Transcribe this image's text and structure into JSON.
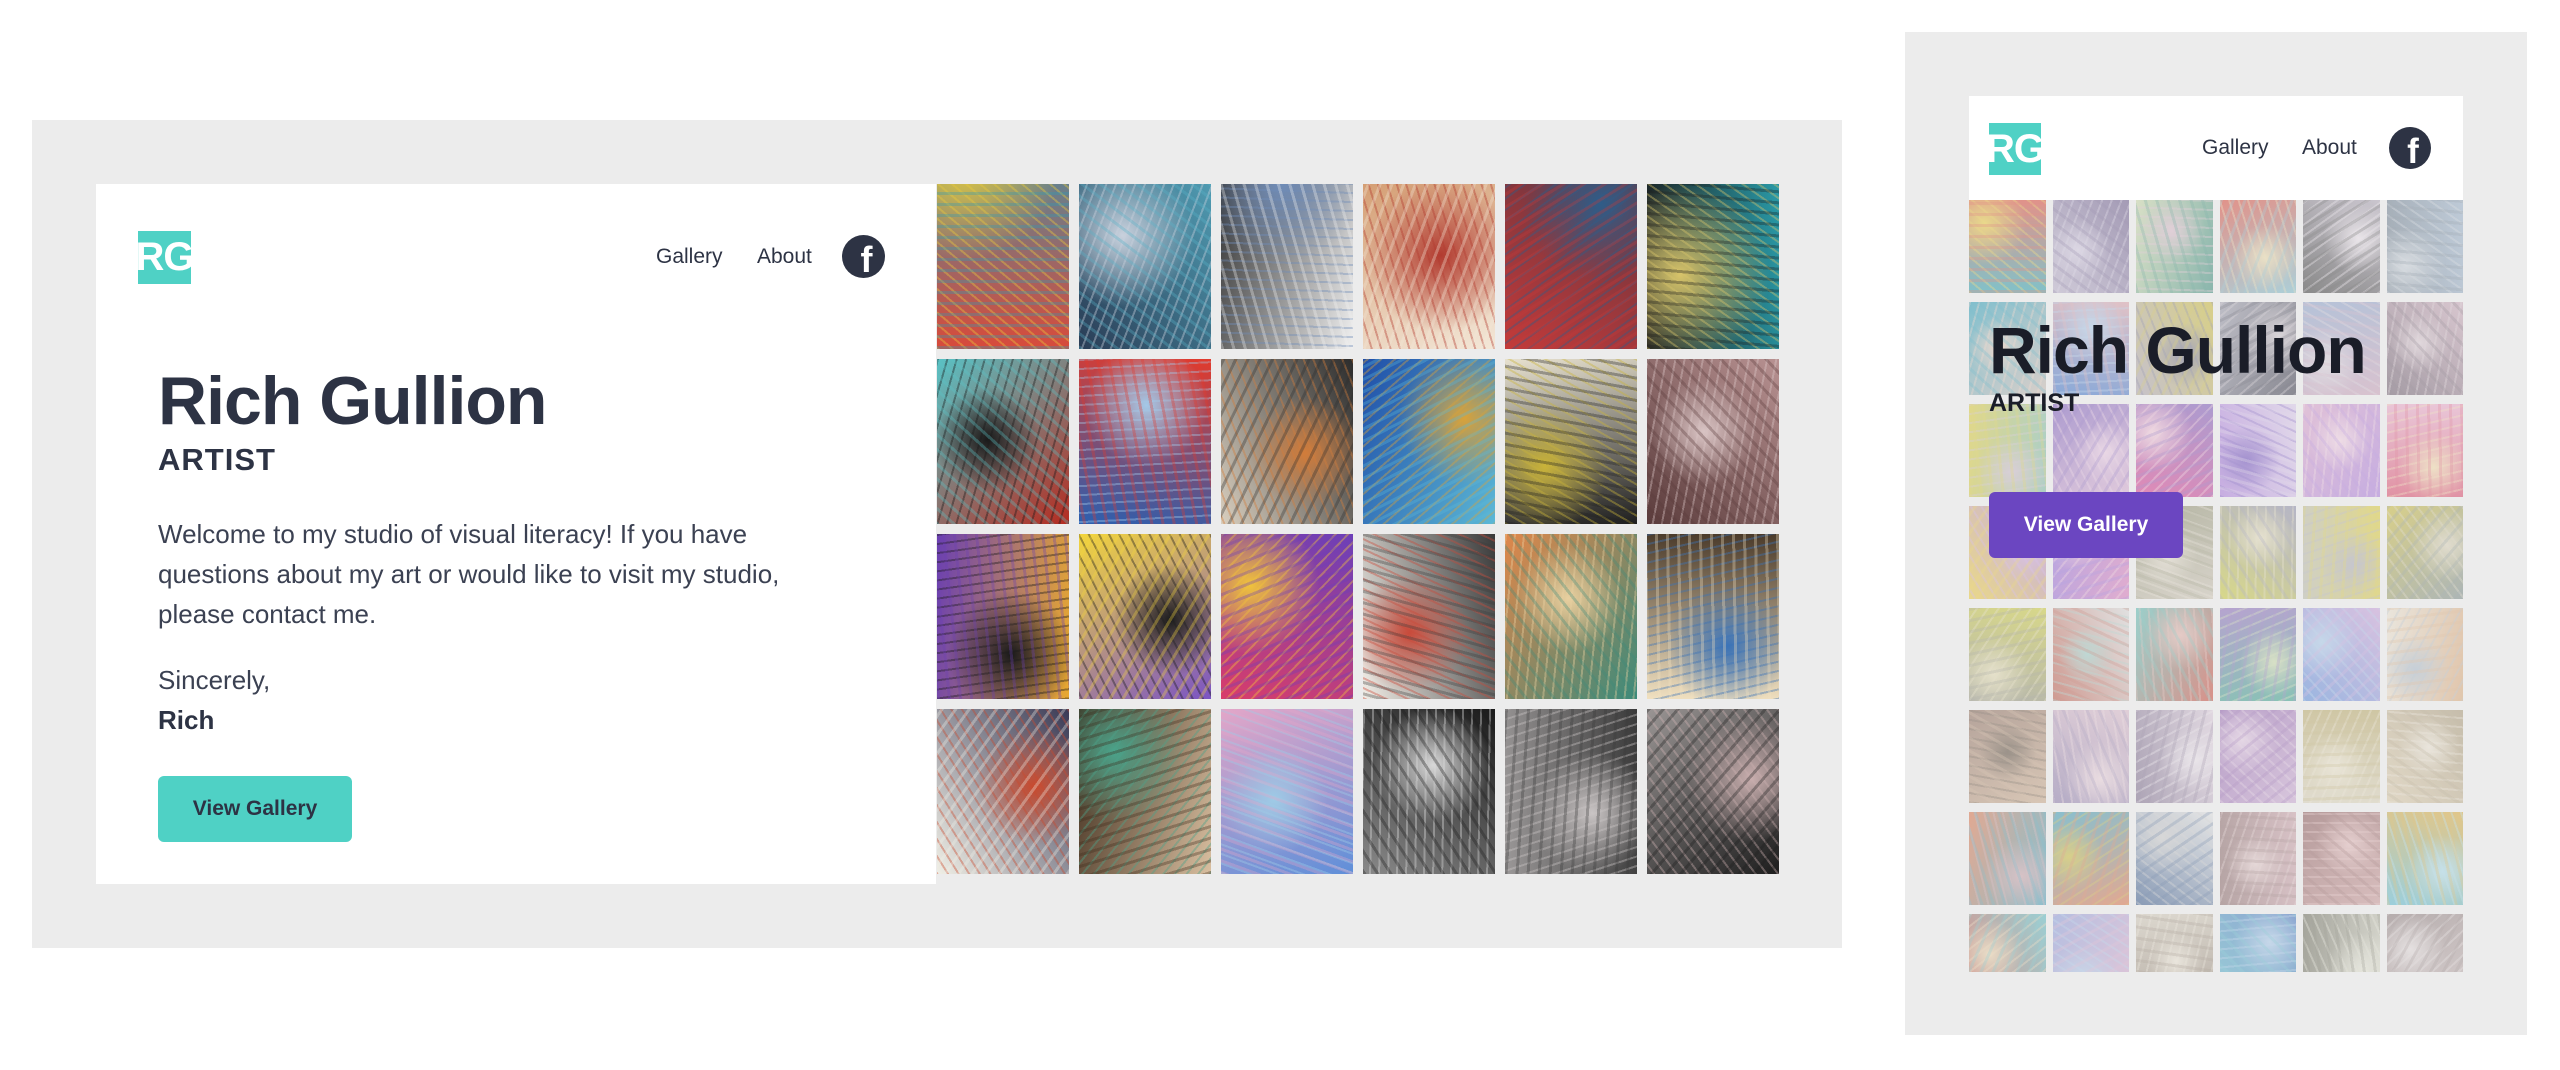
{
  "brand": {
    "logo_text": "RG"
  },
  "nav": {
    "gallery_label": "Gallery",
    "about_label": "About"
  },
  "hero": {
    "name": "Rich Gullion",
    "role": "ARTIST",
    "welcome": "Welcome to my studio of visual literacy! If you have questions about my art or would like to visit my studio, please contact me.",
    "sincerely": "Sincerely,",
    "signature": "Rich",
    "cta_label": "View Gallery"
  },
  "colors": {
    "frame": "#ececec",
    "teal_accent": "#4fd1c5",
    "purple_accent": "#6b46c1",
    "text_dark": "#2d3344"
  },
  "icons": {
    "social": "facebook-icon"
  },
  "desktop_artworks": [
    [
      "#d94a3a",
      "#2f9bb5",
      "#e8c93c"
    ],
    [
      "#2a3c55",
      "#58b2c8",
      "#c9d1dd"
    ],
    [
      "#1c1c1c",
      "#f0f0f0",
      "#6f8cb8"
    ],
    [
      "#c9834e",
      "#f3e7d8",
      "#b23a2f"
    ],
    [
      "#4a3340",
      "#c23a3a",
      "#2f5c88"
    ],
    [
      "#2aa0ae",
      "#1b1b1b",
      "#d8c46a"
    ],
    [
      "#b52b20",
      "#59c2c5",
      "#1a1a1a"
    ],
    [
      "#2b5fb0",
      "#e23a2c",
      "#a4c9e8"
    ],
    [
      "#d9cfbf",
      "#2c2c2c",
      "#d27c3a"
    ],
    [
      "#1f4ea8",
      "#5cb8d6",
      "#d8a23a"
    ],
    [
      "#e7e1cf",
      "#1f1f1f",
      "#c9b339"
    ],
    [
      "#b89292",
      "#5a3b3b",
      "#d9c4c4"
    ],
    [
      "#e9a92f",
      "#6a3fb2",
      "#1a1a1a"
    ],
    [
      "#7b54c4",
      "#f3d53c",
      "#1d1d1d"
    ],
    [
      "#d93d6a",
      "#6c3fb8",
      "#f0c33b"
    ],
    [
      "#f1ede6",
      "#3a3a3a",
      "#c94a3a"
    ],
    [
      "#e0874a",
      "#3c8a7a",
      "#e8d0a0"
    ],
    [
      "#4a3a2a",
      "#f0e0c0",
      "#3a73b8"
    ],
    [
      "#3a3a55",
      "#f0efe6",
      "#c94a2e"
    ],
    [
      "#d9bfa0",
      "#3c2a1a",
      "#4aa38a"
    ],
    [
      "#5f8fd9",
      "#e3a6c8",
      "#9ecbe6"
    ],
    [
      "#8a8a8a",
      "#1a1a1a",
      "#d8d8d8"
    ],
    [
      "#9b9898",
      "#3a3a3a",
      "#c9c4c4"
    ],
    [
      "#9a9594",
      "#1e1e1e",
      "#c9aeae"
    ],
    [
      "#d7d3cf",
      "#6a6a6a",
      "#b8b2ad"
    ],
    [
      "#f2e9de",
      "#c9483a",
      "#e7b38a"
    ],
    [
      "#a9b3bf",
      "#3a5f6f",
      "#d0d4d8"
    ],
    [
      "#1d1d1d",
      "#f0f0f0",
      "#7a7a7a"
    ],
    [
      "#e9e9e9",
      "#c73a3a",
      "#2a6fb8"
    ],
    [
      "#6f6f7a",
      "#2a2a2a",
      "#c8c8c8"
    ]
  ],
  "mobile_artworks": [
    [
      "#2aa0ae",
      "#d94a3a",
      "#e8c93c"
    ],
    [
      "#b9b0c9",
      "#6a5a8a",
      "#d0c8de"
    ],
    [
      "#c9d6a8",
      "#3a8a7a",
      "#d8b8c8"
    ],
    [
      "#d94a3a",
      "#7ab8c8",
      "#e8d8a8"
    ],
    [
      "#b0a8b8",
      "#3a3a3a",
      "#e8e0e8"
    ],
    [
      "#9ab0c8",
      "#6a7a8a",
      "#c8d0d8"
    ],
    [
      "#c9b8b0",
      "#2a9bb5",
      "#e8c8b8"
    ],
    [
      "#3a73c9",
      "#d8a0a8",
      "#a8c8e8"
    ],
    [
      "#a8a0b0",
      "#c8b83a",
      "#6a6a8a"
    ],
    [
      "#9898a8",
      "#3a3a4a",
      "#c8c0c8"
    ],
    [
      "#8aa0c8",
      "#c8a0b8",
      "#d8d0d8"
    ],
    [
      "#c8a8b8",
      "#6a5a6a",
      "#d8c8d0"
    ],
    [
      "#7ab8a8",
      "#d8c83a",
      "#c8b8c8"
    ],
    [
      "#d8b0d0",
      "#7a5ab8",
      "#e8c8e0"
    ],
    [
      "#d83a8a",
      "#7a5ab8",
      "#f0c8d8"
    ],
    [
      "#a87ad8",
      "#d8c8e8",
      "#6a4ab8"
    ],
    [
      "#d8a0c8",
      "#a87ad8",
      "#f0d0e0"
    ],
    [
      "#e8a8c8",
      "#d84a6a",
      "#f0d8a8"
    ],
    [
      "#a87ad8",
      "#e8c83a",
      "#c8a0e0"
    ],
    [
      "#d87ab8",
      "#8a6ad8",
      "#f0c8d8"
    ],
    [
      "#c8c0b0",
      "#8a8a6a",
      "#e0d8c8"
    ],
    [
      "#c8c83a",
      "#8a8aa8",
      "#e0d8b8"
    ],
    [
      "#b8b8a8",
      "#d8c83a",
      "#a8a8b8"
    ],
    [
      "#c8b83a",
      "#7a8a8a",
      "#d8d0b8"
    ],
    [
      "#c8c83a",
      "#8a8a7a",
      "#e0d8b0"
    ],
    [
      "#d8d8d8",
      "#b85a4a",
      "#9ac8c0"
    ],
    [
      "#c9483a",
      "#5ab8b0",
      "#e0b0a8"
    ],
    [
      "#3aa08a",
      "#8a6ab8",
      "#c8d8a8"
    ],
    [
      "#5a8ad8",
      "#c8a0d8",
      "#a8c8e8"
    ],
    [
      "#e8e0d0",
      "#d8a87a",
      "#a8b8c8"
    ],
    [
      "#8a6a5a",
      "#c8a88a",
      "#5a4a3a"
    ],
    [
      "#d8b8c8",
      "#8a7aa8",
      "#e8d0d8"
    ],
    [
      "#d8c8d8",
      "#7a6a8a",
      "#e8e0e8"
    ],
    [
      "#c8a8d0",
      "#8a5aa8",
      "#e0c8e0"
    ],
    [
      "#d8d0b8",
      "#b8a86a",
      "#e8e0c8"
    ],
    [
      "#d8c8a8",
      "#a89878",
      "#e8e0d0"
    ],
    [
      "#d8734a",
      "#3a9bb5",
      "#c8a0a8"
    ],
    [
      "#3a9bb5",
      "#d8734a",
      "#c8b83a"
    ],
    [
      "#e0e0e0",
      "#3a5a8a",
      "#c8c8c8"
    ],
    [
      "#c8a0a8",
      "#8a6a6a",
      "#e0c8c8"
    ],
    [
      "#c89898",
      "#8a5a5a",
      "#e0b8b8"
    ],
    [
      "#5ab8d0",
      "#d8a83a",
      "#a8d8e8"
    ],
    [
      "#c94a3a",
      "#5ab8c0",
      "#e8d0a8"
    ],
    [
      "#8a9ad8",
      "#d8a8c8",
      "#a8c8e8"
    ],
    [
      "#d0c8b8",
      "#8a7a6a",
      "#e8e0d0"
    ],
    [
      "#3a6ab8",
      "#5ab8c8",
      "#a8c8e8"
    ],
    [
      "#c8c8b8",
      "#6a6a5a",
      "#e0e0d0"
    ],
    [
      "#c8b8b8",
      "#8a7a7a",
      "#e0d8d8"
    ]
  ]
}
